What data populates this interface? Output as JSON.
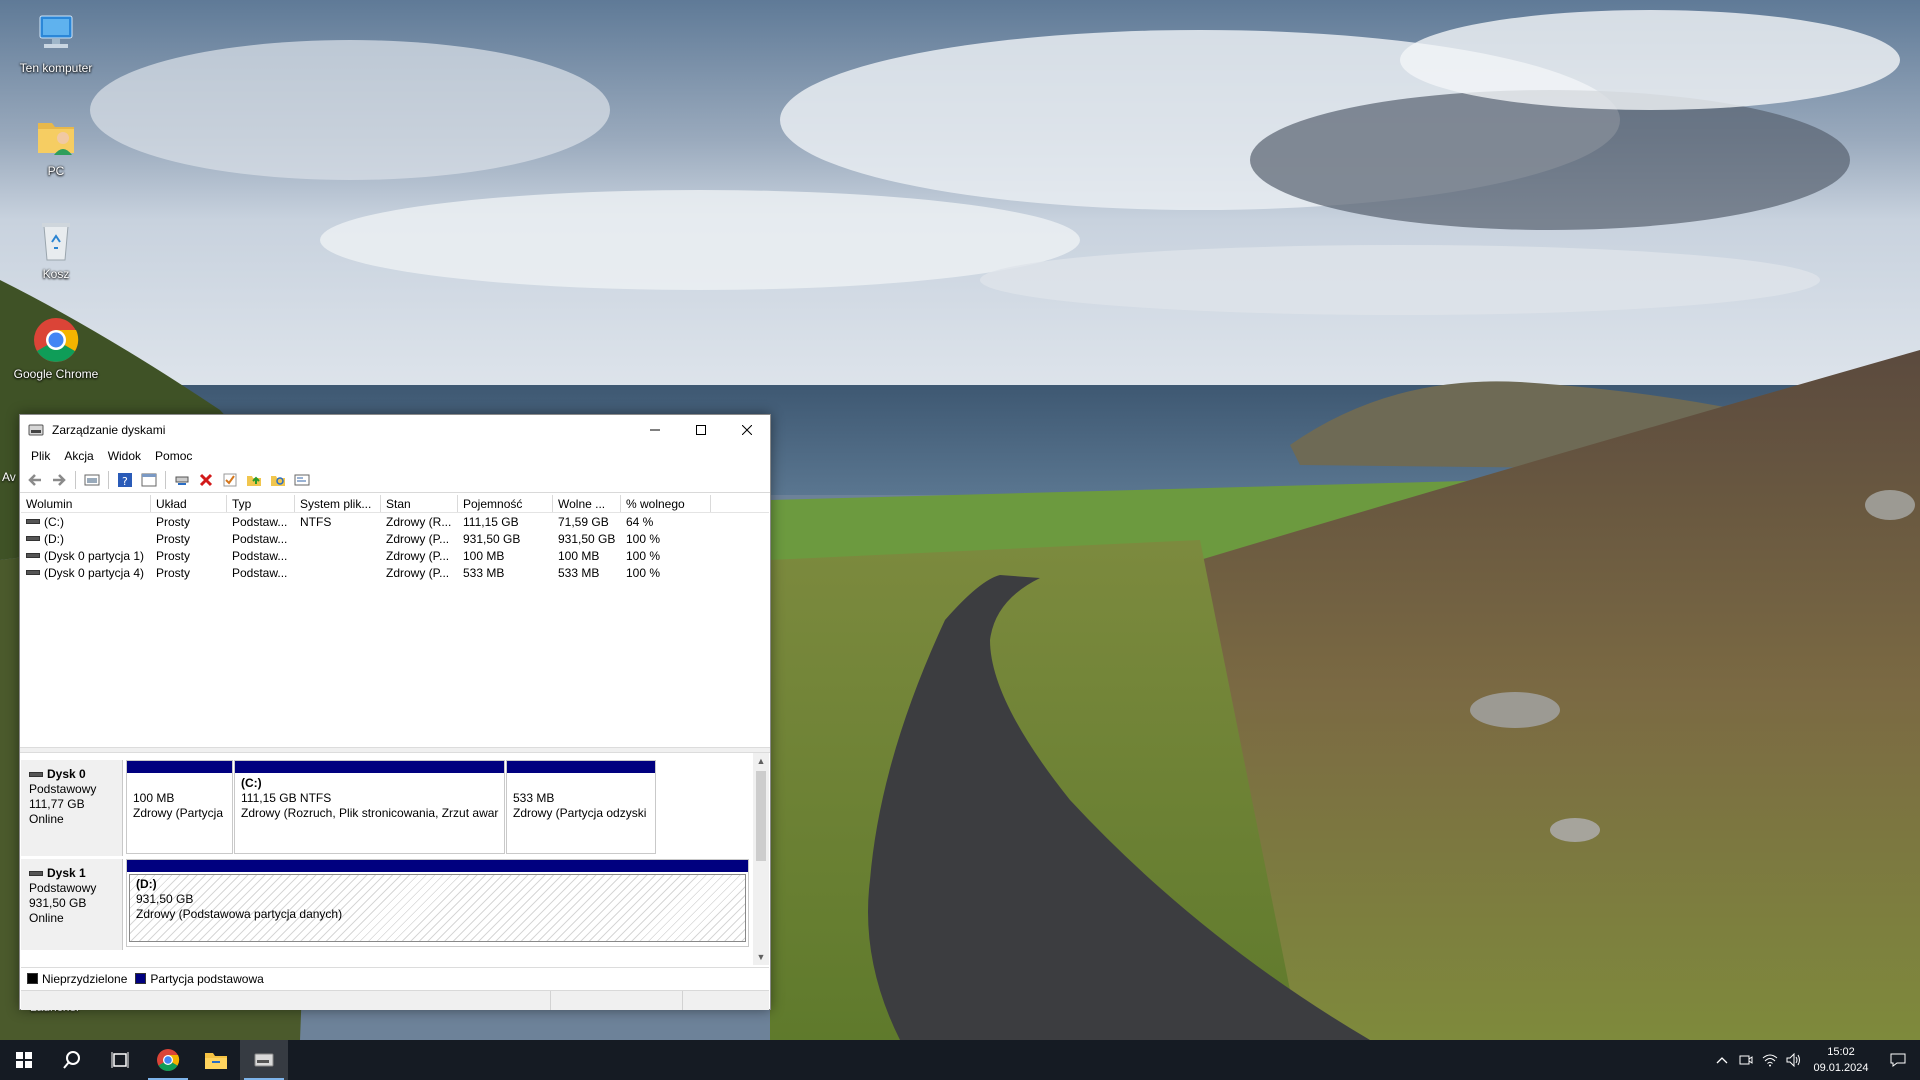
{
  "desktop": {
    "icons": [
      {
        "label": "Ten komputer",
        "icon": "computer-icon"
      },
      {
        "label": "PC",
        "icon": "user-folder-icon"
      },
      {
        "label": "Kosz",
        "icon": "recycle-bin-icon"
      },
      {
        "label": "Google Chrome",
        "icon": "chrome-icon"
      }
    ],
    "partial_labels": [
      "Av",
      "Launcher"
    ]
  },
  "window": {
    "title": "Zarządzanie dyskami",
    "menu": [
      "Plik",
      "Akcja",
      "Widok",
      "Pomoc"
    ],
    "toolbar_icons": [
      "back-icon",
      "forward-icon",
      "properties-icon",
      "help-icon",
      "console-icon",
      "connect-icon",
      "delete-icon",
      "check-icon",
      "open-icon",
      "search-folder-icon",
      "view-icon"
    ],
    "columns": [
      "Wolumin",
      "Układ",
      "Typ",
      "System plik...",
      "Stan",
      "Pojemność",
      "Wolne ...",
      "% wolnego"
    ],
    "volumes": [
      [
        "(C:)",
        "Prosty",
        "Podstaw...",
        "NTFS",
        "Zdrowy (R...",
        "111,15 GB",
        "71,59 GB",
        "64 %"
      ],
      [
        "(D:)",
        "Prosty",
        "Podstaw...",
        "",
        "Zdrowy (P...",
        "931,50 GB",
        "931,50 GB",
        "100 %"
      ],
      [
        "(Dysk 0 partycja 1)",
        "Prosty",
        "Podstaw...",
        "",
        "Zdrowy (P...",
        "100 MB",
        "100 MB",
        "100 %"
      ],
      [
        "(Dysk 0 partycja 4)",
        "Prosty",
        "Podstaw...",
        "",
        "Zdrowy (P...",
        "533 MB",
        "533 MB",
        "100 %"
      ]
    ],
    "disks": [
      {
        "name": "Dysk 0",
        "type": "Podstawowy",
        "size": "111,77 GB",
        "state": "Online",
        "partitions": [
          {
            "name": "",
            "line1": "100 MB",
            "line2": "Zdrowy (Partycja"
          },
          {
            "name": "(C:)",
            "line1": "111,15 GB NTFS",
            "line2": "Zdrowy (Rozruch, Plik stronicowania, Zrzut awar"
          },
          {
            "name": "",
            "line1": "533 MB",
            "line2": "Zdrowy (Partycja odzyski"
          }
        ]
      },
      {
        "name": "Dysk 1",
        "type": "Podstawowy",
        "size": "931,50 GB",
        "state": "Online",
        "partitions": [
          {
            "name": "(D:)",
            "line1": "931,50 GB",
            "line2": "Zdrowy (Podstawowa partycja danych)"
          }
        ]
      }
    ],
    "legend": [
      {
        "label": "Nieprzydzielone",
        "color": "#000000"
      },
      {
        "label": "Partycja podstawowa",
        "color": "#00007f"
      }
    ]
  },
  "taskbar": {
    "apps": [
      "start-icon",
      "search-icon",
      "task-view-icon",
      "chrome-icon",
      "file-explorer-icon",
      "disk-management-icon"
    ],
    "time": "15:02",
    "date": "09.01.2024"
  }
}
